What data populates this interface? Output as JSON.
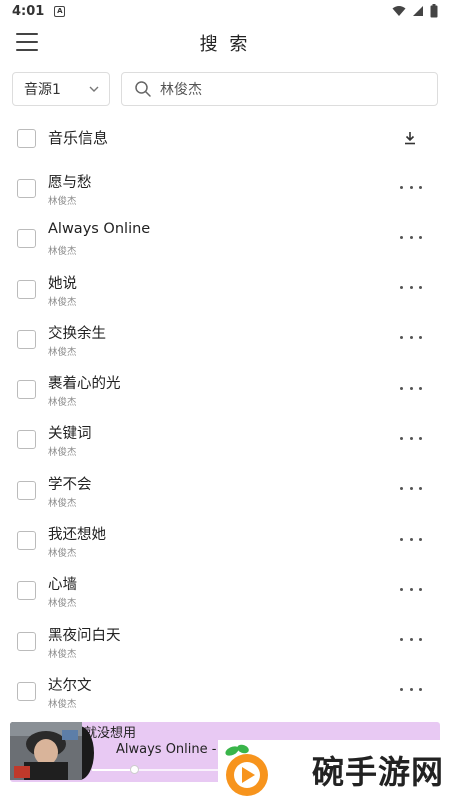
{
  "status_bar": {
    "time": "4:01",
    "notification_icon": "A"
  },
  "header": {
    "title": "搜 索"
  },
  "search": {
    "source": "音源1",
    "query": "林俊杰"
  },
  "list_header": {
    "title": "音乐信息"
  },
  "songs": [
    {
      "title": "愿与愁",
      "artist": "林俊杰"
    },
    {
      "title": "Always Online",
      "artist": "林俊杰"
    },
    {
      "title": "她说",
      "artist": "林俊杰"
    },
    {
      "title": "交换余生",
      "artist": "林俊杰"
    },
    {
      "title": "裹着心的光",
      "artist": "林俊杰"
    },
    {
      "title": "关键词",
      "artist": "林俊杰"
    },
    {
      "title": "学不会",
      "artist": "林俊杰"
    },
    {
      "title": "我还想她",
      "artist": "林俊杰"
    },
    {
      "title": "心墙",
      "artist": "林俊杰"
    },
    {
      "title": "黑夜问白天",
      "artist": "林俊杰"
    },
    {
      "title": "达尔文",
      "artist": "林俊杰"
    }
  ],
  "player": {
    "peek_title": "就没想用",
    "now_playing": "Always Online - 林",
    "progress": 0.3,
    "background": "#e8c9f3"
  },
  "watermark": {
    "text": "碗手游网"
  },
  "colors": {
    "accent_orange": "#f7941d",
    "accent_green": "#39b54a"
  }
}
